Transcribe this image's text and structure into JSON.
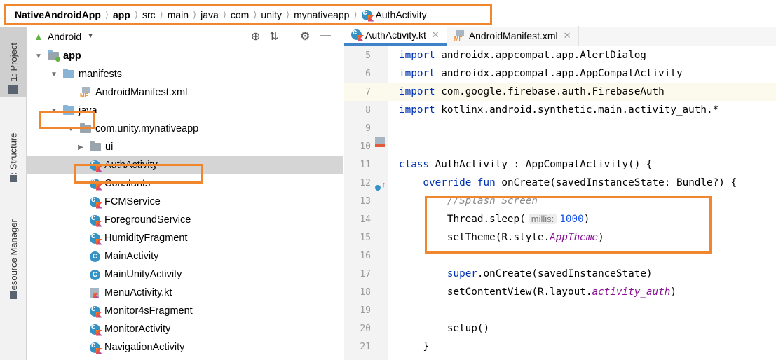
{
  "breadcrumb": {
    "items": [
      "NativeAndroidApp",
      "app",
      "src",
      "main",
      "java",
      "com",
      "unity",
      "mynativeapp",
      "AuthActivity"
    ],
    "bold": [
      true,
      true,
      false,
      false,
      false,
      false,
      false,
      false,
      false
    ]
  },
  "left_strip": {
    "tabs": [
      "1: Project",
      "Z: Structure",
      "Resource Manager"
    ]
  },
  "project": {
    "view_label": "Android",
    "tree": [
      {
        "label": "app",
        "depth": 0,
        "expander": "open",
        "icon": "app-module-icon",
        "bold": true
      },
      {
        "label": "manifests",
        "depth": 1,
        "expander": "open",
        "icon": "folder-icon"
      },
      {
        "label": "AndroidManifest.xml",
        "depth": 2,
        "expander": "none",
        "icon": "manifest-file-icon"
      },
      {
        "label": "java",
        "depth": 1,
        "expander": "open",
        "icon": "folder-icon"
      },
      {
        "label": "com.unity.mynativeapp",
        "depth": 2,
        "expander": "open",
        "icon": "package-icon"
      },
      {
        "label": "ui",
        "depth": 3,
        "expander": "closed",
        "icon": "package-icon"
      },
      {
        "label": "AuthActivity",
        "depth": 3,
        "expander": "none",
        "icon": "kotlin-class-icon",
        "selected": true
      },
      {
        "label": "Constants",
        "depth": 3,
        "expander": "none",
        "icon": "kotlin-class-icon"
      },
      {
        "label": "FCMService",
        "depth": 3,
        "expander": "none",
        "icon": "kotlin-class-icon"
      },
      {
        "label": "ForegroundService",
        "depth": 3,
        "expander": "none",
        "icon": "kotlin-class-icon"
      },
      {
        "label": "HumidityFragment",
        "depth": 3,
        "expander": "none",
        "icon": "kotlin-class-icon"
      },
      {
        "label": "MainActivity",
        "depth": 3,
        "expander": "none",
        "icon": "java-class-icon"
      },
      {
        "label": "MainUnityActivity",
        "depth": 3,
        "expander": "none",
        "icon": "java-class-icon"
      },
      {
        "label": "MenuActivity.kt",
        "depth": 3,
        "expander": "none",
        "icon": "kotlin-file-icon"
      },
      {
        "label": "Monitor4sFragment",
        "depth": 3,
        "expander": "none",
        "icon": "kotlin-class-icon"
      },
      {
        "label": "MonitorActivity",
        "depth": 3,
        "expander": "none",
        "icon": "kotlin-class-icon"
      },
      {
        "label": "NavigationActivity",
        "depth": 3,
        "expander": "none",
        "icon": "kotlin-class-icon"
      }
    ]
  },
  "editor": {
    "tabs": [
      {
        "label": "AuthActivity.kt",
        "icon": "kotlin-class-icon",
        "active": true
      },
      {
        "label": "AndroidManifest.xml",
        "icon": "manifest-file-icon",
        "active": false
      }
    ],
    "lines": [
      {
        "n": "5",
        "text": "import androidx.appcompat.app.AlertDialog"
      },
      {
        "n": "6",
        "text": "import androidx.appcompat.app.AppCompatActivity"
      },
      {
        "n": "7",
        "text": "import com.google.firebase.auth.FirebaseAuth"
      },
      {
        "n": "8",
        "text": "import kotlinx.android.synthetic.main.activity_auth.*"
      },
      {
        "n": "9",
        "text": ""
      },
      {
        "n": "10",
        "text": ""
      },
      {
        "n": "11",
        "text": "class AuthActivity : AppCompatActivity() {"
      },
      {
        "n": "12",
        "text": "    override fun onCreate(savedInstanceState: Bundle?) {"
      },
      {
        "n": "13",
        "text": "        //Splash Screen"
      },
      {
        "n": "14",
        "text": "        Thread.sleep( millis: 1000)"
      },
      {
        "n": "15",
        "text": "        setTheme(R.style.AppTheme)"
      },
      {
        "n": "16",
        "text": ""
      },
      {
        "n": "17",
        "text": "        super.onCreate(savedInstanceState)"
      },
      {
        "n": "18",
        "text": "        setContentView(R.layout.activity_auth)"
      },
      {
        "n": "19",
        "text": ""
      },
      {
        "n": "20",
        "text": "        setup()"
      },
      {
        "n": "21",
        "text": "    }"
      }
    ],
    "hint_label": "millis:"
  },
  "colors": {
    "highlight": "#f0862e",
    "keyword": "#0033b3",
    "comment": "#8c8c8c",
    "number": "#1750eb",
    "italic_ref": "#871094"
  }
}
